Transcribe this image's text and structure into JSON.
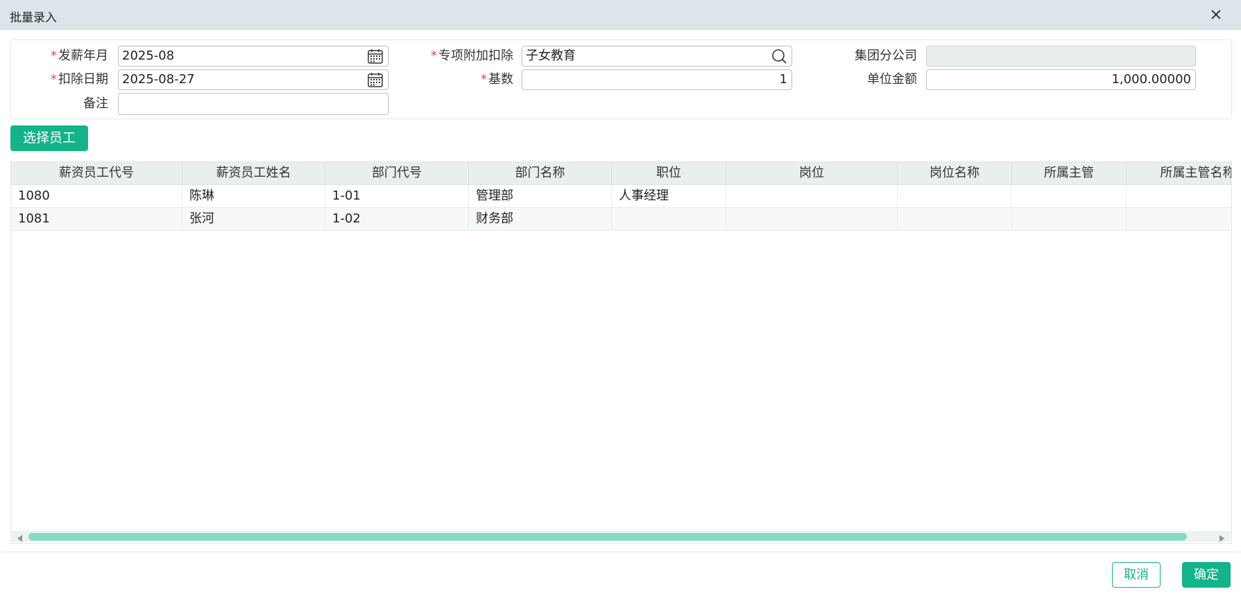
{
  "window": {
    "title": "批量录入"
  },
  "form": {
    "pay_month": {
      "label": "发薪年月",
      "value": "2025-08",
      "required": true
    },
    "special_deduction": {
      "label": "专项附加扣除",
      "value": "子女教育",
      "required": true
    },
    "group_branch": {
      "label": "集团分公司",
      "value": ""
    },
    "deduct_date": {
      "label": "扣除日期",
      "value": "2025-08-27",
      "required": true
    },
    "base_count": {
      "label": "基数",
      "value": "1",
      "required": true
    },
    "unit_amount": {
      "label": "单位金额",
      "value": "1,000.00000"
    },
    "remark": {
      "label": "备注",
      "value": ""
    },
    "required_mark": "*"
  },
  "actions": {
    "select_employee": "选择员工",
    "cancel": "取消",
    "confirm": "确定"
  },
  "table": {
    "columns": [
      "薪资员工代号",
      "薪资员工姓名",
      "部门代号",
      "部门名称",
      "职位",
      "岗位",
      "岗位名称",
      "所属主管",
      "所属主管名称"
    ],
    "rows": [
      [
        "1080",
        "陈琳",
        "1-01",
        "管理部",
        "人事经理",
        "",
        "",
        "",
        ""
      ],
      [
        "1081",
        "张河",
        "1-02",
        "财务部",
        "",
        "",
        "",
        "",
        ""
      ]
    ]
  },
  "colors": {
    "accent": "#14b38a",
    "required": "#e14b4b",
    "titlebar": "#dce6ea",
    "scroll_thumb": "#83dcc3"
  },
  "icons": {
    "close": "close-icon",
    "calendar": "calendar-icon",
    "search": "search-icon",
    "scroll_left": "arrow-left-icon",
    "scroll_right": "arrow-right-icon"
  }
}
